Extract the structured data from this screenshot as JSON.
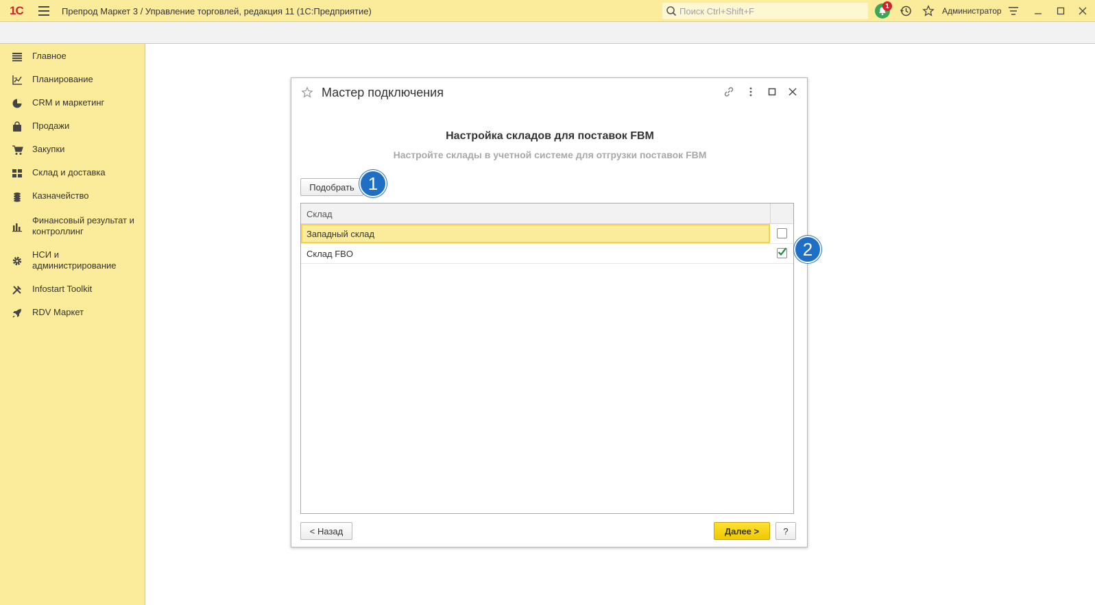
{
  "app": {
    "logo": "1С",
    "title": "Препрод Маркет 3 / Управление торговлей, редакция 11  (1С:Предприятие)",
    "search_placeholder": "Поиск Ctrl+Shift+F",
    "notifications_count": "1",
    "user": "Администратор"
  },
  "sidebar": {
    "items": [
      {
        "label": "Главное",
        "icon": "menu-list-icon"
      },
      {
        "label": "Планирование",
        "icon": "planning-chart-icon"
      },
      {
        "label": "CRM и маркетинг",
        "icon": "pie-chart-icon"
      },
      {
        "label": "Продажи",
        "icon": "shopping-bag-icon"
      },
      {
        "label": "Закупки",
        "icon": "cart-icon"
      },
      {
        "label": "Склад и доставка",
        "icon": "warehouse-grid-icon"
      },
      {
        "label": "Казначейство",
        "icon": "coins-icon"
      },
      {
        "label": "Финансовый результат и контроллинг",
        "icon": "bar-chart-icon"
      },
      {
        "label": "НСИ и администрирование",
        "icon": "gear-icon"
      },
      {
        "label": "Infostart Toolkit",
        "icon": "tools-icon"
      },
      {
        "label": "RDV Маркет",
        "icon": "rocket-icon"
      }
    ]
  },
  "dialog": {
    "title": "Мастер подключения",
    "heading": "Настройка складов для поставок FBM",
    "subheading": "Настройте склады в учетной системе для отгрузки поставок FBM",
    "pick_button": "Подобрать",
    "callout_1": "1",
    "callout_2": "2",
    "grid": {
      "column": "Склад",
      "rows": [
        {
          "name": "Западный склад",
          "checked": false
        },
        {
          "name": "Склад FBO",
          "checked": true
        }
      ]
    },
    "back_button": "< Назад",
    "next_button": "Далее >",
    "help_button": "?"
  }
}
